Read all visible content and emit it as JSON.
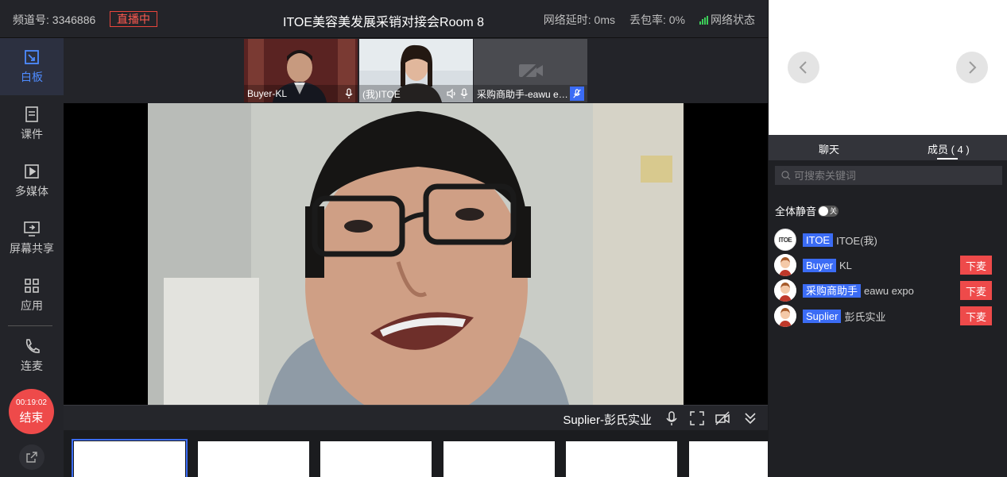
{
  "header": {
    "channel": "频道号: 3346886",
    "live_badge": "直播中",
    "room_title": "ITOE美容美发展采销对接会Room 8",
    "latency": "网络延时: 0ms",
    "packet_loss": "丢包率: 0%",
    "network_status": "网络状态"
  },
  "sidebar": {
    "items": [
      {
        "label": "白板",
        "icon": "whiteboard-icon"
      },
      {
        "label": "课件",
        "icon": "courseware-icon"
      },
      {
        "label": "多媒体",
        "icon": "multimedia-icon"
      },
      {
        "label": "屏幕共享",
        "icon": "screen-share-icon"
      },
      {
        "label": "应用",
        "icon": "apps-icon"
      },
      {
        "label": "连麦",
        "icon": "phone-icon"
      }
    ],
    "end_timer": "00:19:02",
    "end_label": "结束"
  },
  "thumbnails": [
    {
      "name": "Buyer-KL"
    },
    {
      "name": "(我)ITOE"
    },
    {
      "name": "采购商助手-eawu expo"
    }
  ],
  "main_video": {
    "speaker": "Suplier-彭氏实业"
  },
  "right_panel": {
    "tabs": [
      "聊天",
      "成员 ( 4 )"
    ],
    "active_tab": 1,
    "search_placeholder": "可搜索关键词",
    "mute_all_label": "全体静音",
    "mute_toggle_text": "关",
    "avatar_logo_text": "ITOE",
    "members": [
      {
        "role": "ITOE",
        "name": "ITOE(我)",
        "kick": ""
      },
      {
        "role": "Buyer",
        "name": "KL",
        "kick": "下麦"
      },
      {
        "role": "采购商助手",
        "name": "eawu expo",
        "kick": "下麦"
      },
      {
        "role": "Suplier",
        "name": "彭氏实业",
        "kick": "下麦"
      }
    ]
  },
  "colors": {
    "accent": "#3b6cf5",
    "danger": "#ee4a4a",
    "background": "#1b1c1f"
  }
}
